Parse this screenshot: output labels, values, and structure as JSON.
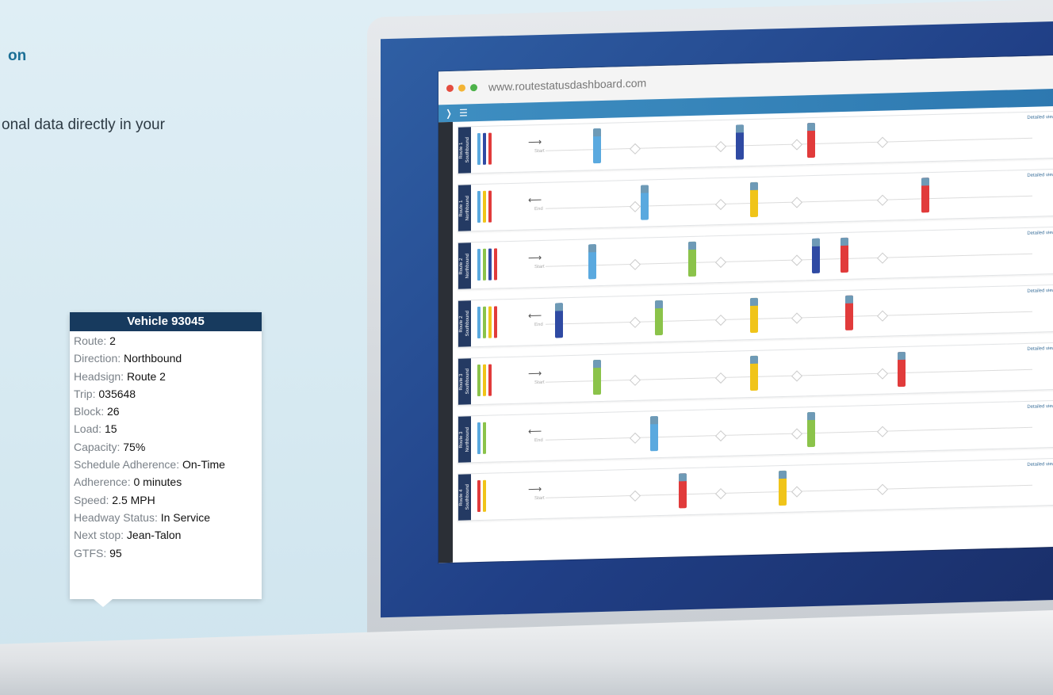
{
  "header": {
    "title": "on",
    "subtitle": "onal data directly in your"
  },
  "browser": {
    "url": "www.routestatusdashboard.com",
    "traffic_lights": [
      "#e44c3f",
      "#f3b435",
      "#4db24a"
    ]
  },
  "tooltip": {
    "title": "Vehicle 93045",
    "rows": [
      {
        "label": "Route:",
        "value": "2"
      },
      {
        "label": "Direction:",
        "value": "Northbound"
      },
      {
        "label": "Headsign:",
        "value": "Route 2"
      },
      {
        "label": "Trip:",
        "value": "035648"
      },
      {
        "label": "Block:",
        "value": "26"
      },
      {
        "label": "Load:",
        "value": "15"
      },
      {
        "label": "Capacity:",
        "value": "75%"
      },
      {
        "label": "Schedule Adherence:",
        "value": "On-Time"
      },
      {
        "label": "Adherence:",
        "value": "0 minutes"
      },
      {
        "label": "Speed:",
        "value": "2.5 MPH"
      },
      {
        "label": "Headway Status:",
        "value": "In Service"
      },
      {
        "label": "Next stop:",
        "value": "Jean-Talon"
      },
      {
        "label": "GTFS:",
        "value": "95"
      }
    ]
  },
  "dashboard": {
    "rows": [
      {
        "route": "Route 1",
        "dir": "Southbound",
        "arrow": "⟶",
        "end": "Start",
        "detail": "Detailed view »",
        "bars": [
          "#5aa9df",
          "#2f4aa3",
          "#e13b3b"
        ],
        "buses": [
          {
            "x": 0.1,
            "c": "#5aa9df"
          },
          {
            "x": 0.4,
            "c": "#2f4aa3"
          },
          {
            "x": 0.55,
            "c": "#e13b3b"
          }
        ]
      },
      {
        "route": "Route 1",
        "dir": "Northbound",
        "arrow": "⟵",
        "end": "End",
        "detail": "Detailed view »",
        "bars": [
          "#5aa9df",
          "#f0c419",
          "#e13b3b"
        ],
        "buses": [
          {
            "x": 0.2,
            "c": "#5aa9df"
          },
          {
            "x": 0.43,
            "c": "#f0c419"
          },
          {
            "x": 0.79,
            "c": "#e13b3b"
          }
        ]
      },
      {
        "route": "Route 2",
        "dir": "Northbound",
        "arrow": "⟶",
        "end": "Start",
        "detail": "Detailed view »",
        "bars": [
          "#5aa9df",
          "#8bc34a",
          "#2f4aa3",
          "#e13b3b"
        ],
        "buses": [
          {
            "x": 0.09,
            "c": "#5aa9df"
          },
          {
            "x": 0.3,
            "c": "#8bc34a"
          },
          {
            "x": 0.56,
            "c": "#2f4aa3"
          },
          {
            "x": 0.62,
            "c": "#e13b3b"
          }
        ]
      },
      {
        "route": "Route 2",
        "dir": "Southbound",
        "arrow": "⟵",
        "end": "End",
        "detail": "Detailed view »",
        "bars": [
          "#5aa9df",
          "#8bc34a",
          "#f0c419",
          "#e13b3b"
        ],
        "buses": [
          {
            "x": 0.02,
            "c": "#2f4aa3"
          },
          {
            "x": 0.23,
            "c": "#8bc34a"
          },
          {
            "x": 0.43,
            "c": "#f0c419"
          },
          {
            "x": 0.63,
            "c": "#e13b3b"
          }
        ]
      },
      {
        "route": "Route 3",
        "dir": "Southbound",
        "arrow": "⟶",
        "end": "Start",
        "detail": "Detailed view »",
        "bars": [
          "#8bc34a",
          "#f0c419",
          "#e13b3b"
        ],
        "buses": [
          {
            "x": 0.1,
            "c": "#8bc34a"
          },
          {
            "x": 0.43,
            "c": "#f0c419"
          },
          {
            "x": 0.74,
            "c": "#e13b3b"
          }
        ]
      },
      {
        "route": "Route 3",
        "dir": "Northbound",
        "arrow": "⟵",
        "end": "End",
        "detail": "Detailed view »",
        "bars": [
          "#5aa9df",
          "#8bc34a"
        ],
        "buses": [
          {
            "x": 0.22,
            "c": "#5aa9df"
          },
          {
            "x": 0.55,
            "c": "#8bc34a"
          }
        ]
      },
      {
        "route": "Route 4",
        "dir": "Southbound",
        "arrow": "⟶",
        "end": "Start",
        "detail": "Detailed view »",
        "bars": [
          "#e13b3b",
          "#f0c419"
        ],
        "buses": [
          {
            "x": 0.28,
            "c": "#e13b3b"
          },
          {
            "x": 0.49,
            "c": "#f0c419"
          }
        ]
      }
    ]
  }
}
